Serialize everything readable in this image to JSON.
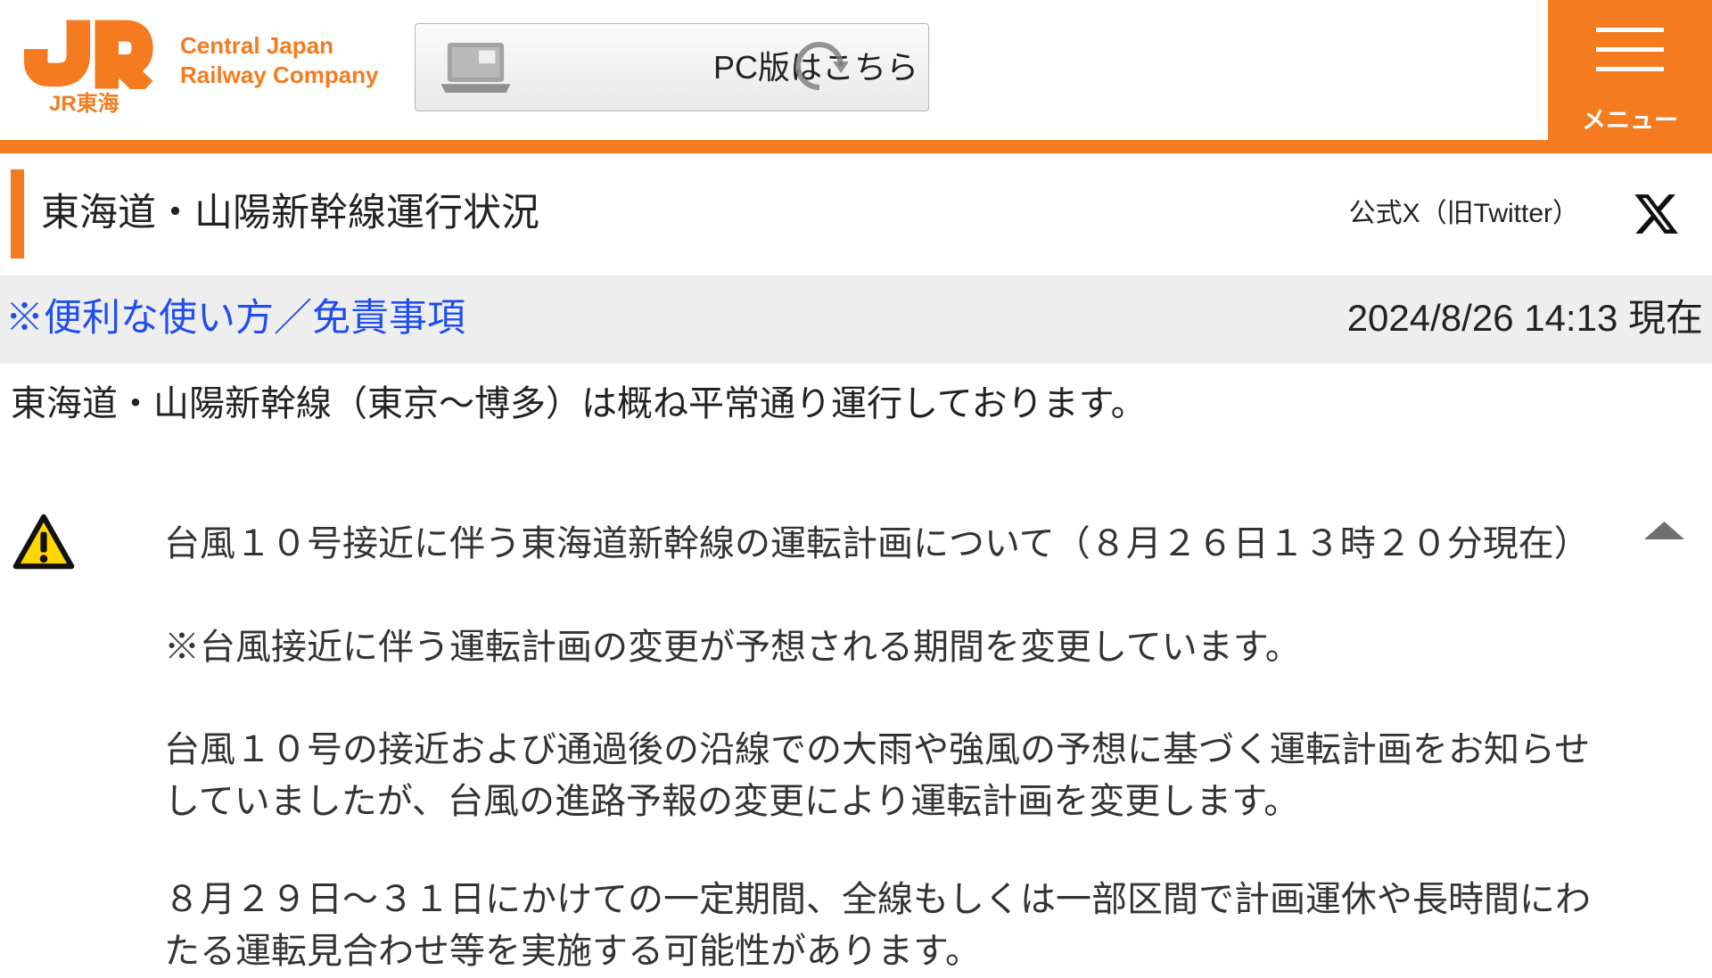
{
  "header": {
    "logo": {
      "mark": "JR",
      "caption": "JR東海"
    },
    "company_name": {
      "line1": "Central Japan",
      "line2": "Railway Company"
    },
    "pc_button": {
      "label": "PC版はこちら"
    },
    "menu_button": {
      "label": "メニュー"
    }
  },
  "title_bar": {
    "title": "東海道・山陽新幹線運行状況",
    "official_x_label": "公式X（旧Twitter）"
  },
  "info_bar": {
    "help_link": "※便利な使い方／免責事項",
    "timestamp": "2024/8/26 14:13 現在"
  },
  "status_message": "東海道・山陽新幹線（東京～博多）は概ね平常通り運行しております。",
  "notice": {
    "heading": "台風１０号接近に伴う東海道新幹線の運転計画について（８月２６日１３時２０分現在）",
    "paragraphs": [
      "※台風接近に伴う運転計画の変更が予想される期間を変更しています。",
      "台風１０号の接近および通過後の沿線での大雨や強風の予想に基づく運転計画をお知らせしていましたが、台風の進路予報の変更により運転計画を変更します。",
      "８月２９日～３１日にかけての一定期間、全線もしくは一部区間で計画運休や長時間にわたる運転見合わせ等を実施する可能性があります。"
    ]
  },
  "icons": {
    "logo": "jr-central-logo",
    "pc_button": "laptop-icon",
    "loading": "loading-spinner-icon",
    "menu": "hamburger-menu-icon",
    "official_x": "x-logo-icon",
    "notice": "warning-icon",
    "collapse": "chevron-up-icon"
  },
  "colors": {
    "brand_orange": "#f47b20",
    "link_blue": "#1f4ef0",
    "info_bar_background": "#eeeeee",
    "text": "#222222",
    "warning_yellow": "#ffd500"
  }
}
